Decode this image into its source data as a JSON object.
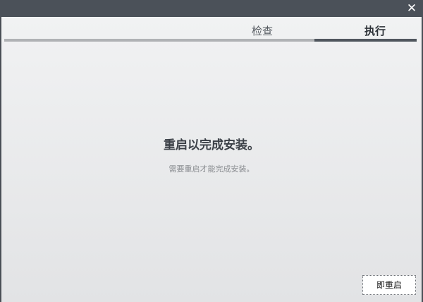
{
  "titlebar": {
    "close_glyph": "✕",
    "close_icon": "close-icon"
  },
  "steps": {
    "items": [
      {
        "label": "检查",
        "state": "done"
      },
      {
        "label": "执行",
        "state": "active"
      }
    ],
    "current_step": 2,
    "total_steps": 2
  },
  "main": {
    "heading": "重启以完成安装。",
    "subtext": "需要重启才能完成安装。"
  },
  "footer": {
    "restart_label": "即重启"
  },
  "colors": {
    "titlebar": "#4b5159",
    "active_step": "#50565e",
    "completed_track": "#b0b2b5"
  }
}
